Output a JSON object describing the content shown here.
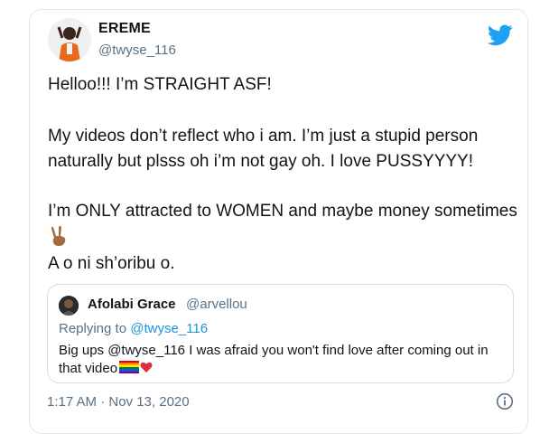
{
  "tweet": {
    "author_name": "EREME",
    "author_handle": "@twyse_116",
    "lines": {
      "l1": "Helloo!!! I’m STRAIGHT ASF!",
      "l2": "My videos don’t reflect who i am. I’m just a stupid person",
      "l3": "naturally but plsss oh i’m not gay oh. I love PUSSYYYY!",
      "l4": "I’m ONLY attracted to WOMEN and maybe money sometimes",
      "l5": "A o ni sh’oribu o."
    },
    "timestamp": "1:17 AM · Nov 13, 2020"
  },
  "quoted": {
    "author_name": "Afolabi Grace",
    "author_handle": "@arvellou",
    "replying_prefix": "Replying to",
    "replying_handle": "@twyse_116",
    "text_line1": "Big ups @twyse_116 I was afraid you won't find love after coming out in",
    "text_line2": "that video"
  },
  "icons": {
    "brand": "twitter-bird-icon",
    "info": "info-icon",
    "emoji1": "victory-hand-emoji",
    "emoji2": "rainbow-flag-emoji",
    "emoji3": "red-heart-emoji"
  },
  "colors": {
    "twitter_blue": "#1da1f2",
    "secondary_text": "#5b7083",
    "border": "#e1e8ed"
  }
}
